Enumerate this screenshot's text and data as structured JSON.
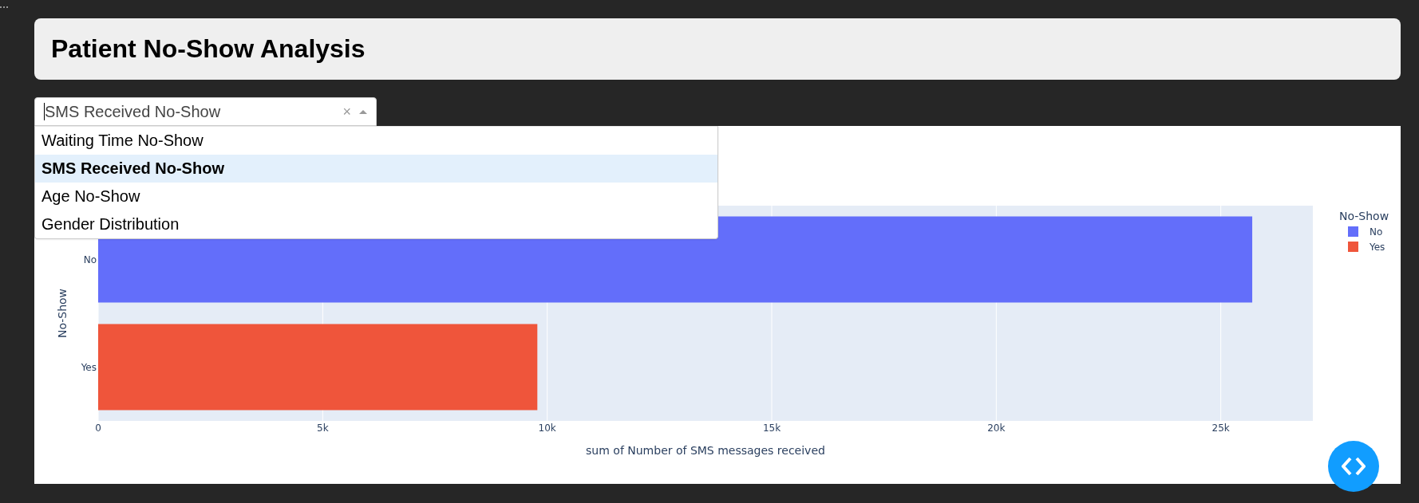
{
  "header": {
    "title": "Patient No-Show Analysis"
  },
  "dropdown": {
    "value": "SMS Received No-Show",
    "focused": true,
    "clear_symbol": "×",
    "open": true,
    "options": [
      {
        "label": "Waiting Time No-Show",
        "selected": false
      },
      {
        "label": "SMS Received No-Show",
        "selected": true
      },
      {
        "label": "Age No-Show",
        "selected": false
      },
      {
        "label": "Gender Distribution",
        "selected": false
      }
    ]
  },
  "chart": {
    "chart_data": {
      "type": "bar",
      "orientation": "h",
      "xlabel": "sum of Number of SMS messages received",
      "ylabel": "No-Show",
      "grid": {
        "x": true,
        "y": false
      },
      "legend": "right",
      "legend_title": "No-Show",
      "categories": [
        "No",
        "Yes"
      ],
      "series": [
        {
          "name": "No",
          "color": "#636efa",
          "values": [
            25700,
            null
          ]
        },
        {
          "name": "Yes",
          "color": "#ef553b",
          "values": [
            null,
            9780
          ]
        }
      ],
      "xlim": [
        0,
        27050
      ],
      "xticks": [
        0,
        {
          "value": 5000,
          "label": "5k"
        },
        {
          "value": 10000,
          "label": "10k"
        },
        {
          "value": 15000,
          "label": "15k"
        },
        {
          "value": 20000,
          "label": "20k"
        },
        {
          "value": 25000,
          "label": "25k"
        }
      ]
    }
  }
}
